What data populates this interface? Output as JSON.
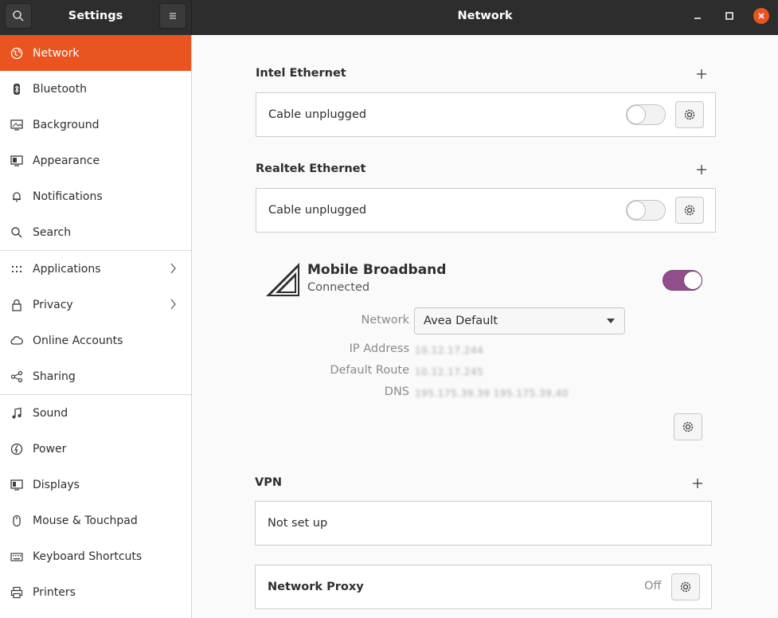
{
  "header": {
    "sidebar_title": "Settings",
    "main_title": "Network"
  },
  "sidebar": {
    "items": [
      {
        "label": "Network",
        "icon": "network-icon"
      },
      {
        "label": "Bluetooth",
        "icon": "bluetooth-icon"
      },
      {
        "label": "Background",
        "icon": "background-icon"
      },
      {
        "label": "Appearance",
        "icon": "appearance-icon"
      },
      {
        "label": "Notifications",
        "icon": "bell-icon"
      },
      {
        "label": "Search",
        "icon": "search-icon"
      },
      {
        "label": "Applications",
        "icon": "grid-icon"
      },
      {
        "label": "Privacy",
        "icon": "lock-icon"
      },
      {
        "label": "Online Accounts",
        "icon": "cloud-icon"
      },
      {
        "label": "Sharing",
        "icon": "share-icon"
      },
      {
        "label": "Sound",
        "icon": "music-note-icon"
      },
      {
        "label": "Power",
        "icon": "power-icon"
      },
      {
        "label": "Displays",
        "icon": "display-icon"
      },
      {
        "label": "Mouse & Touchpad",
        "icon": "mouse-icon"
      },
      {
        "label": "Keyboard Shortcuts",
        "icon": "keyboard-icon"
      },
      {
        "label": "Printers",
        "icon": "printer-icon"
      }
    ]
  },
  "main": {
    "intel": {
      "title": "Intel Ethernet",
      "status": "Cable unplugged",
      "enabled": false
    },
    "realtek": {
      "title": "Realtek Ethernet",
      "status": "Cable unplugged",
      "enabled": false
    },
    "mobile": {
      "name": "Mobile Broadband",
      "status": "Connected",
      "enabled": true,
      "network_label": "Network",
      "network_value": "Avea Default",
      "ip_label": "IP Address",
      "ip_value": "10.12.17.244",
      "route_label": "Default Route",
      "route_value": "10.12.17.245",
      "dns_label": "DNS",
      "dns_value": "195.175.39.39 195.175.39.40"
    },
    "vpn": {
      "title": "VPN",
      "status": "Not set up"
    },
    "proxy": {
      "label": "Network Proxy",
      "state": "Off"
    }
  },
  "colors": {
    "accent": "#e95420",
    "toggle_on": "#924d8b",
    "headerbar": "#2d2d2d"
  }
}
